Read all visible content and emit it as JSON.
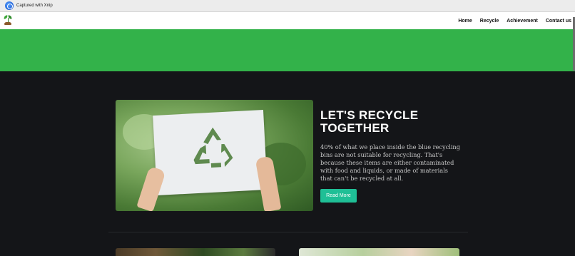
{
  "capture_bar": {
    "text": "Captured with Xnip"
  },
  "nav": {
    "items": [
      {
        "label": "Home"
      },
      {
        "label": "Recycle"
      },
      {
        "label": "Achievement"
      },
      {
        "label": "Contact us"
      }
    ]
  },
  "hero": {
    "title": "LET'S RECYCLE TOGETHER",
    "description": "40% of what we place inside the blue recycling bins are not suitable for recycling. That's because these items are either contaminated with food and liquids, or made of materials that can't be recycled at all.",
    "button_label": "Read More"
  },
  "colors": {
    "green_band": "#33b24a",
    "background": "#141518",
    "button": "#1fbf96"
  }
}
